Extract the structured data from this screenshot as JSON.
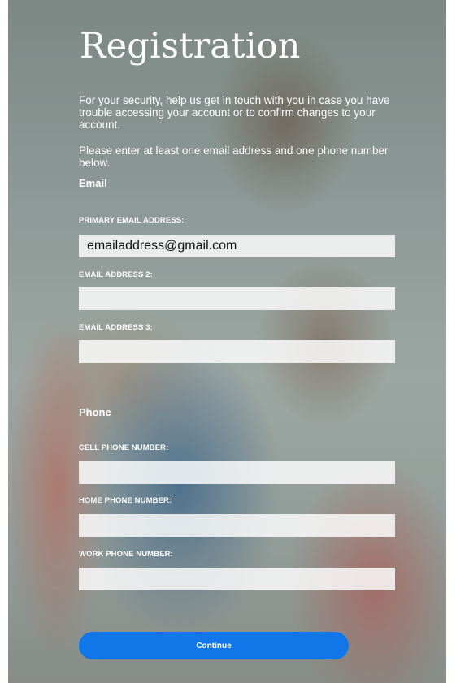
{
  "page": {
    "title": "Registration",
    "intro": "For your security, help us get in touch with you in case you have trouble accessing your account or to confirm changes to your account.",
    "instruction": "Please enter at least one email address and one phone number below."
  },
  "email": {
    "heading": "Email",
    "primary_label": "PRIMARY EMAIL ADDRESS:",
    "primary_value": "emailaddress@gmail.com",
    "email2_label": "EMAIL ADDRESS 2:",
    "email2_value": "",
    "email3_label": "EMAIL ADDRESS 3:",
    "email3_value": ""
  },
  "phone": {
    "heading": "Phone",
    "cell_label": "CELL PHONE NUMBER:",
    "cell_value": "",
    "home_label": "HOME PHONE NUMBER:",
    "home_value": "",
    "work_label": "WORK PHONE NUMBER:",
    "work_value": ""
  },
  "actions": {
    "continue_label": "Continue"
  },
  "colors": {
    "accent": "#1177e8",
    "text": "#ffffff"
  }
}
